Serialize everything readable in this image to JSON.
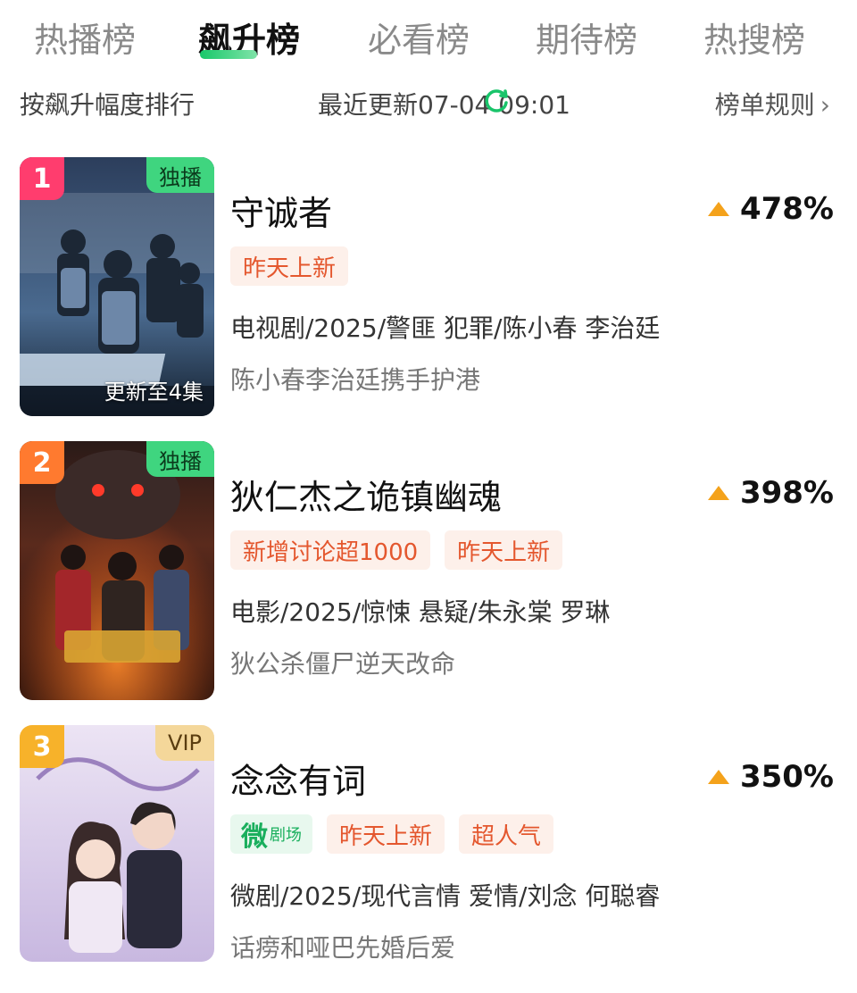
{
  "tabs": [
    {
      "label": "热播榜",
      "active": false
    },
    {
      "label": "飙升榜",
      "active": true
    },
    {
      "label": "必看榜",
      "active": false
    },
    {
      "label": "期待榜",
      "active": false
    },
    {
      "label": "热搜榜",
      "active": false
    }
  ],
  "subbar": {
    "sort_desc": "按飙升幅度排行",
    "update_time": "最近更新07-04 09:01",
    "rules_label": "榜单规则",
    "accent_color": "#19c46a"
  },
  "items": [
    {
      "rank": "1",
      "rank_color": "#ff3d6e",
      "corner_badge": "独播",
      "episode_label": "更新至4集",
      "title": "守诚者",
      "rise": "478%",
      "tags": [
        "昨天上新"
      ],
      "meta": "电视剧/2025/警匪 犯罪/陈小春 李治廷",
      "desc": "陈小春李治廷携手护港"
    },
    {
      "rank": "2",
      "rank_color": "#ff7a2f",
      "corner_badge": "独播",
      "episode_label": "",
      "title": "狄仁杰之诡镇幽魂",
      "rise": "398%",
      "tags": [
        "新增讨论超1000",
        "昨天上新"
      ],
      "meta": "电影/2025/惊悚 悬疑/朱永棠 罗琳",
      "desc": "狄公杀僵尸逆天改命"
    },
    {
      "rank": "3",
      "rank_color": "#f7b22a",
      "corner_badge": "VIP",
      "episode_label": "",
      "title": "念念有词",
      "rise": "350%",
      "micro_tag": "微",
      "micro_tag_sub": "剧场",
      "tags": [
        "昨天上新",
        "超人气"
      ],
      "meta": "微剧/2025/现代言情 爱情/刘念 何聪睿",
      "desc": "话痨和哑巴先婚后爱"
    }
  ]
}
